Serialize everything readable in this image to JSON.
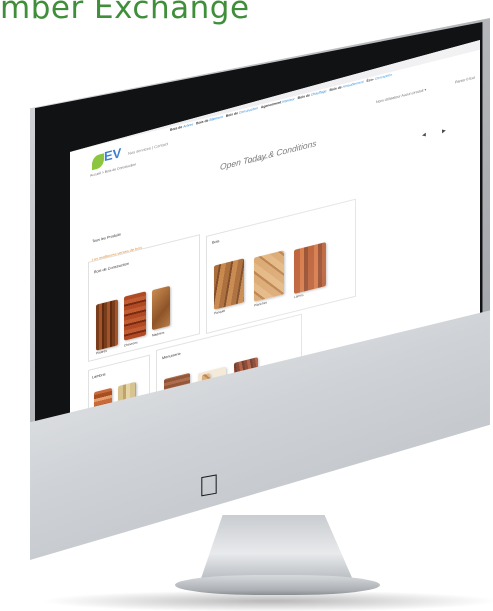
{
  "headline": "mber Exchange",
  "screen": {
    "logo_text": "EV",
    "logo_subtitle": "Nos services | Contact",
    "user_line": "Nom Utilisateur Aucun produit ▾",
    "cart_line": "Panier 0 Eur",
    "nav": [
      {
        "label": "Bois de",
        "sub": "Arbres"
      },
      {
        "label": "Bois de",
        "sub": "Bâtiment"
      },
      {
        "label": "Bois de",
        "sub": "Construction"
      },
      {
        "label": "Agencement",
        "sub": "Intérieur"
      },
      {
        "label": "Bois de",
        "sub": "Chauffage"
      },
      {
        "label": "Bois de",
        "sub": "Ameublement"
      },
      {
        "label": "Éco-",
        "sub": "Conception"
      }
    ],
    "hero_title": "Open Today & Conditions",
    "hero_subtitle": "Nos produits",
    "breadcrumb": "Accueil > Bois de Construction",
    "prev_button": "◀",
    "next_button": "▶",
    "section_products": "Tous les Produits",
    "section_highlight": "Les meilleures ventes de bois",
    "panel1_title": "Bois de Construction",
    "panel2_title": "Bois",
    "panel3_title": "Lambris",
    "panel4_title": "Menuiserie",
    "captions": {
      "poutres": "Poutres",
      "chevrons": "Chevrons",
      "madriers": "Madriers",
      "parquet": "Parquet",
      "planches": "Planches",
      "lames": "Lames"
    },
    "scroll_left": "◀",
    "scroll_right": "▶"
  }
}
